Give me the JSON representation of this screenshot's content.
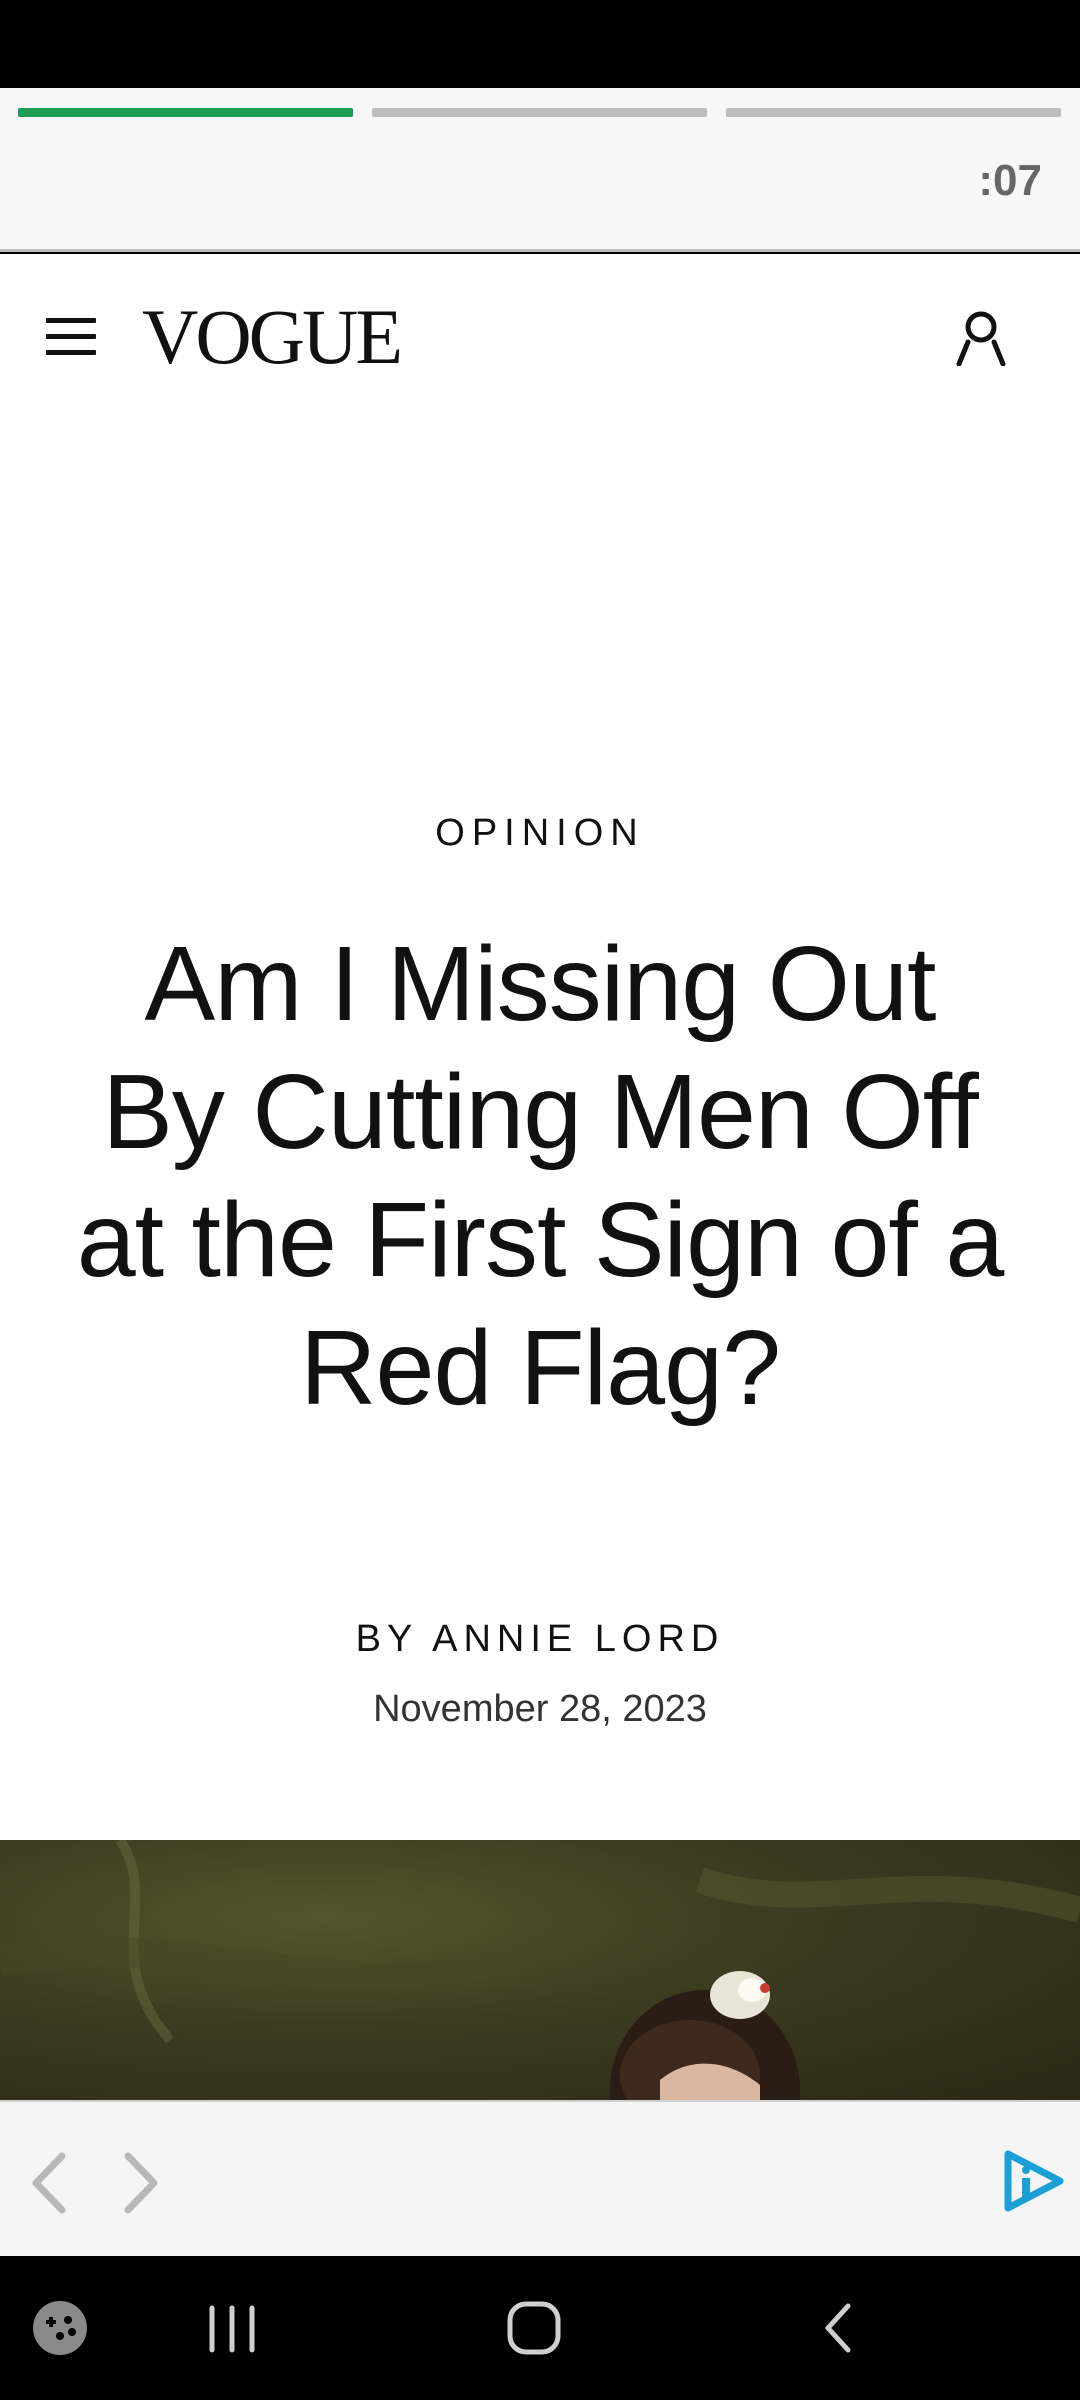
{
  "ad_bar": {
    "timer": ":07",
    "progress": [
      1.0,
      0.0,
      0.0
    ],
    "progress_color": "#1f9d55"
  },
  "header": {
    "logo": "VOGUE",
    "menu_icon": "hamburger-menu-icon",
    "account_icon": "person-icon"
  },
  "article": {
    "rubric": "OPINION",
    "headline": "Am I Missing Out By Cutting Men Off at the First Sign of a Red Flag?",
    "byline_prefix": "BY",
    "author": "ANNIE LORD",
    "date": "November 28, 2023"
  },
  "hero_image": {
    "description_icon": "painting-image"
  },
  "ad_nav": {
    "back_icon": "chevron-left-icon",
    "forward_icon": "chevron-right-icon",
    "adchoices_icon": "adchoices-icon",
    "accent_color": "#1a9fd6"
  },
  "system_nav": {
    "icons": [
      "game-launcher-icon",
      "recent-apps-icon",
      "home-icon",
      "back-icon"
    ]
  }
}
